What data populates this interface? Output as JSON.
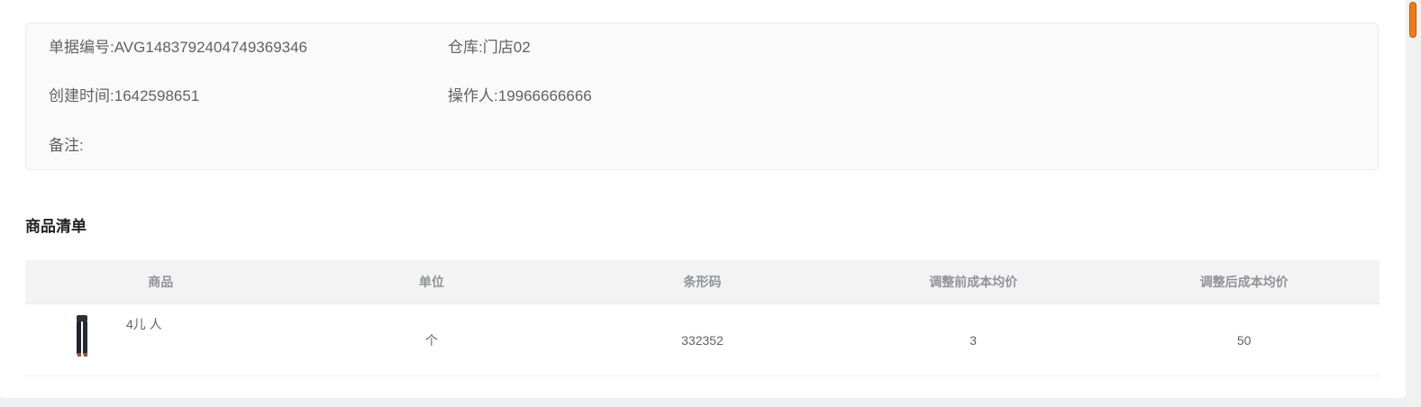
{
  "info": {
    "doc_no_label": "单据编号:",
    "doc_no_value": "AVG1483792404749369346",
    "warehouse_label": "仓库:",
    "warehouse_value": "门店02",
    "created_label": "创建时间:",
    "created_value": "1642598651",
    "operator_label": "操作人:",
    "operator_value": "19966666666",
    "remark_label": "备注:",
    "remark_value": ""
  },
  "goods": {
    "title": "商品清单",
    "columns": [
      "商品",
      "单位",
      "条形码",
      "调整前成本均价",
      "调整后成本均价"
    ],
    "rows": [
      {
        "name": "4儿 人",
        "thumb_icon": "product-thumbnail-icon",
        "unit": "个",
        "barcode": "332352",
        "cost_before": "3",
        "cost_after": "50"
      }
    ]
  },
  "colors": {
    "scroll_accent": "#f07a1a"
  }
}
